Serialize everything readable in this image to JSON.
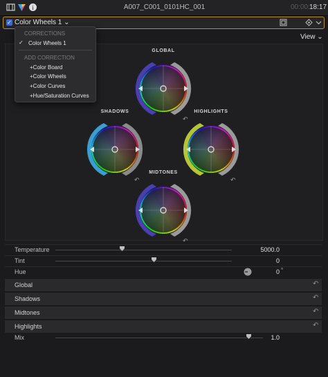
{
  "header": {
    "clip_name": "A007_C001_0101HC_001",
    "timecode_dim": "00:00:",
    "timecode": "18:17",
    "icons": [
      "film-strip-icon",
      "color-prism-icon",
      "info-icon"
    ]
  },
  "correction_bar": {
    "label": "Color Wheels 1 ⌄",
    "checked": true
  },
  "view_button": "View ⌄",
  "menu": {
    "section_corrections": "CORRECTIONS",
    "current": "Color Wheels 1",
    "checkmark": "✓",
    "section_add": "ADD CORRECTION",
    "items": [
      "+Color Board",
      "+Color Wheels",
      "+Color Curves",
      "+Hue/Saturation Curves"
    ]
  },
  "wheels": {
    "global": "GLOBAL",
    "shadows": "SHADOWS",
    "highlights": "HIGHLIGHTS",
    "midtones": "MIDTONES"
  },
  "sliders": {
    "temperature": {
      "label": "Temperature",
      "value": "5000.0"
    },
    "tint": {
      "label": "Tint",
      "value": "0"
    },
    "hue": {
      "label": "Hue",
      "value": "0",
      "unit": "°"
    }
  },
  "sections": [
    "Global",
    "Shadows",
    "Midtones",
    "Highlights"
  ],
  "mix": {
    "label": "Mix",
    "value": "1.0"
  },
  "colors": {
    "accent": "#3d6bd6",
    "selection_border": "#b88f2a"
  }
}
